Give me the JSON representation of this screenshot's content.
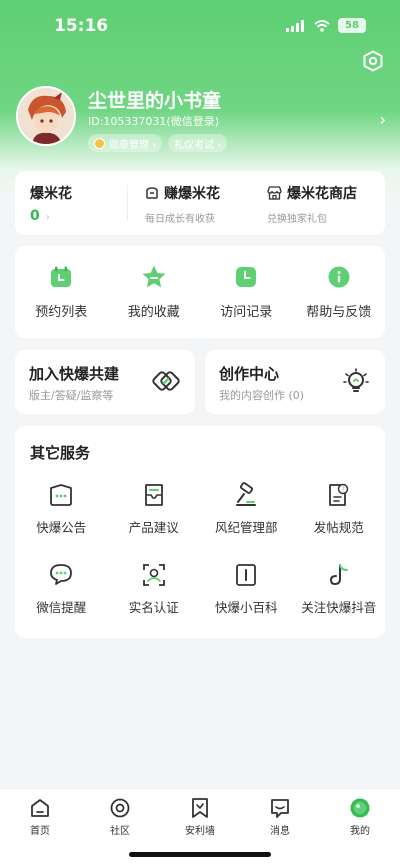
{
  "status_bar": {
    "time": "15:16",
    "battery": "58"
  },
  "profile": {
    "name": "尘世里的小书童",
    "id_text": "ID:105337031(微信登录)",
    "tags": [
      {
        "label": "勋章管理 ›"
      },
      {
        "label": "礼仪考试 ›"
      }
    ],
    "arrow": "›"
  },
  "popcorn": {
    "title": "爆米花",
    "count": "0",
    "count_arrow": "›",
    "earn_title": "赚爆米花",
    "earn_sub": "每日成长有收获",
    "shop_title": "爆米花商店",
    "shop_sub": "兑换独家礼包"
  },
  "quick": [
    {
      "label": "预约列表",
      "icon": "calendar-icon"
    },
    {
      "label": "我的收藏",
      "icon": "star-icon"
    },
    {
      "label": "访问记录",
      "icon": "clock-icon"
    },
    {
      "label": "帮助与反馈",
      "icon": "info-icon"
    }
  ],
  "features": {
    "left": {
      "title": "加入快爆共建",
      "sub": "版主/答疑/监察等"
    },
    "right": {
      "title": "创作中心",
      "sub": "我的内容创作 (0)"
    }
  },
  "services": {
    "title": "其它服务",
    "items": [
      {
        "label": "快爆公告",
        "icon": "announcement-icon"
      },
      {
        "label": "产品建议",
        "icon": "suggestion-icon"
      },
      {
        "label": "风纪管理部",
        "icon": "gavel-icon"
      },
      {
        "label": "发帖规范",
        "icon": "rules-icon"
      },
      {
        "label": "微信提醒",
        "icon": "wechat-icon"
      },
      {
        "label": "实名认证",
        "icon": "face-scan-icon"
      },
      {
        "label": "快爆小百科",
        "icon": "book-icon"
      },
      {
        "label": "关注快爆抖音",
        "icon": "tiktok-icon"
      }
    ]
  },
  "tabbar": [
    {
      "label": "首页",
      "icon": "home-icon"
    },
    {
      "label": "社区",
      "icon": "community-icon"
    },
    {
      "label": "安利墙",
      "icon": "bookmark-icon"
    },
    {
      "label": "消息",
      "icon": "message-icon"
    },
    {
      "label": "我的",
      "icon": "profile-icon",
      "active": true
    }
  ],
  "colors": {
    "accent": "#5ecf72",
    "accent_dark": "#2fba54",
    "background": "#f4f5f7"
  }
}
